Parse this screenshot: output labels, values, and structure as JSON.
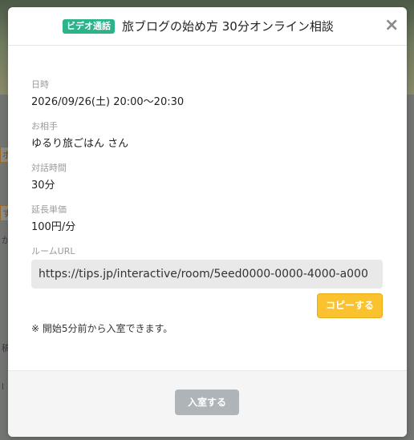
{
  "modal": {
    "badge": "ビデオ通話",
    "title": "旅ブログの始め方 30分オンライン相談",
    "close_glyph": "×"
  },
  "fields": {
    "datetime_label": "日時",
    "datetime_value": "2026/09/26(土) 20:00〜20:30",
    "partner_label": "お相手",
    "partner_value": "ゆるり旅ごはん さん",
    "duration_label": "対話時間",
    "duration_value": "30分",
    "extension_label": "延長単価",
    "extension_value": "100円/分",
    "room_url_label": "ルームURL",
    "room_url_value": "https://tips.jp/interactive/room/5eed0000-0000-4000-a000"
  },
  "buttons": {
    "copy": "コピーする",
    "enter": "入室する"
  },
  "note": "※ 開始5分前から入室できます。",
  "background": {
    "frag1": "ボ",
    "frag2": "す",
    "frag3": "が",
    "frag4": "稿",
    "frag5": "l"
  },
  "colors": {
    "badge": "#2bb38a",
    "copy_button": "#f9c22e",
    "enter_button_disabled": "#aeb4b8"
  }
}
